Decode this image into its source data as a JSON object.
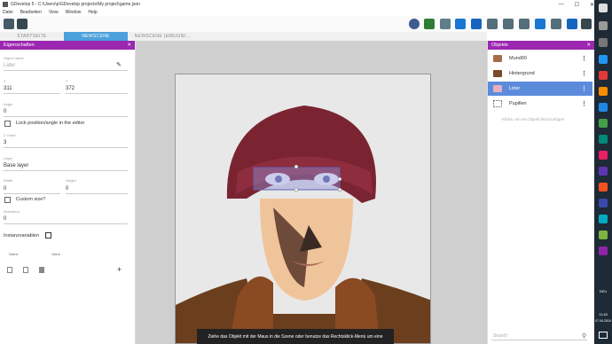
{
  "window": {
    "title": "GDevelop 5 - C:\\Users\\p\\GDevelop projects\\My project\\game.json",
    "minimize": "—",
    "maximize": "☐",
    "close": "✕"
  },
  "menu": [
    "Datei",
    "Bearbeiten",
    "View",
    "Window",
    "Help"
  ],
  "tabs": [
    {
      "label": "STARTSEITE",
      "active": false
    },
    {
      "label": "NEWSCENE",
      "active": true
    },
    {
      "label": "NEWSCENE (EREIGNI...",
      "active": false
    }
  ],
  "properties": {
    "header": "Eigenschaften",
    "object_name_label": "Object name",
    "object_name_value": "Lider",
    "x_label": "X",
    "x_value": "311",
    "y_label": "Y",
    "y_value": "372",
    "angle_label": "Angle",
    "angle_value": "0",
    "lock_label": "Lock position/angle in the editor",
    "zorder_label": "Z Order",
    "zorder_value": "3",
    "layer_label": "Layer",
    "layer_value": "Base layer",
    "width_label": "Width",
    "width_value": "0",
    "height_label": "Height",
    "height_value": "0",
    "custom_size_label": "Custom size?",
    "animation_label": "Animation",
    "animation_value": "0",
    "instance_vars_label": "Instanzvariablen",
    "vars_name_col": "Name",
    "vars_value_col": "Value",
    "add_symbol": "+"
  },
  "objects": {
    "header": "Objekte",
    "items": [
      {
        "label": "Mund00",
        "selected": false
      },
      {
        "label": "Hintergrund",
        "selected": false
      },
      {
        "label": "Lider",
        "selected": true
      },
      {
        "label": "Pupillen",
        "selected": false
      }
    ],
    "add_hint": "Klicke, um ein Objekt hinzuzufügen",
    "search_placeholder": "Search"
  },
  "scene_hint": "Ziehe das Objekt mit der Maus in die Szene oder benutze das Rechtsklick-Menü um eine",
  "taskbar": {
    "lang": "DEU",
    "time": "11:40",
    "date": "07.04.2018"
  }
}
